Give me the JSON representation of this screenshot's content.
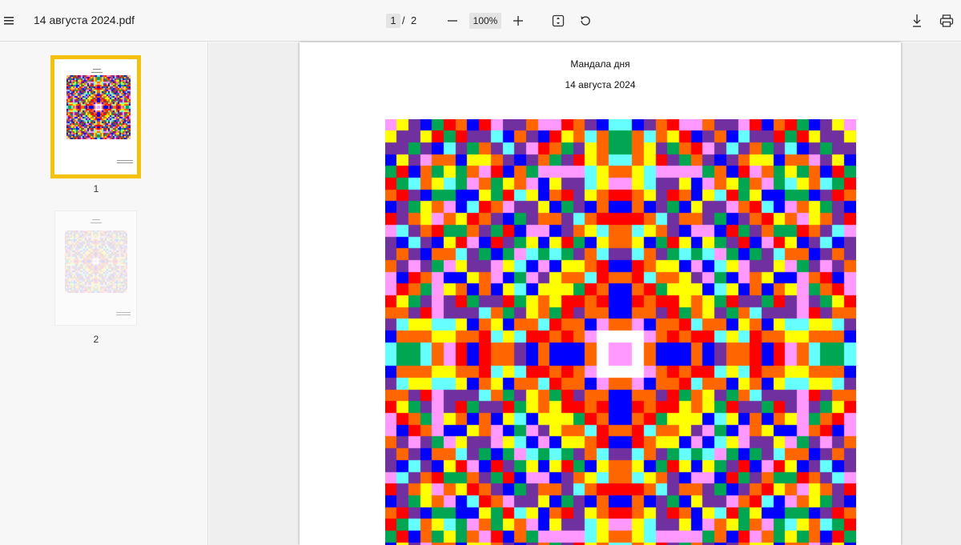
{
  "toolbar": {
    "menu_icon": "hamburger-menu-icon",
    "doc_title": "14 августа 2024.pdf",
    "page_current": "1",
    "page_separator": "/",
    "page_total": "2",
    "zoom_level": "100%",
    "icons": [
      "zoom-out-icon",
      "zoom-in-icon",
      "fit-page-icon",
      "rotate-icon",
      "download-icon",
      "print-icon"
    ]
  },
  "sidebar": {
    "thumbnails": [
      {
        "label": "1",
        "selected": true
      },
      {
        "label": "2",
        "selected": false
      }
    ],
    "selected_color": "#f4c20d"
  },
  "document": {
    "title": "Мандала дня",
    "date": "14 августа 2024"
  },
  "palette": [
    "#ff0000",
    "#ff6600",
    "#ffff00",
    "#00a651",
    "#66ffff",
    "#0000ff",
    "#ff99ff",
    "#7030a0",
    "#ffffff",
    "#3399ff"
  ]
}
